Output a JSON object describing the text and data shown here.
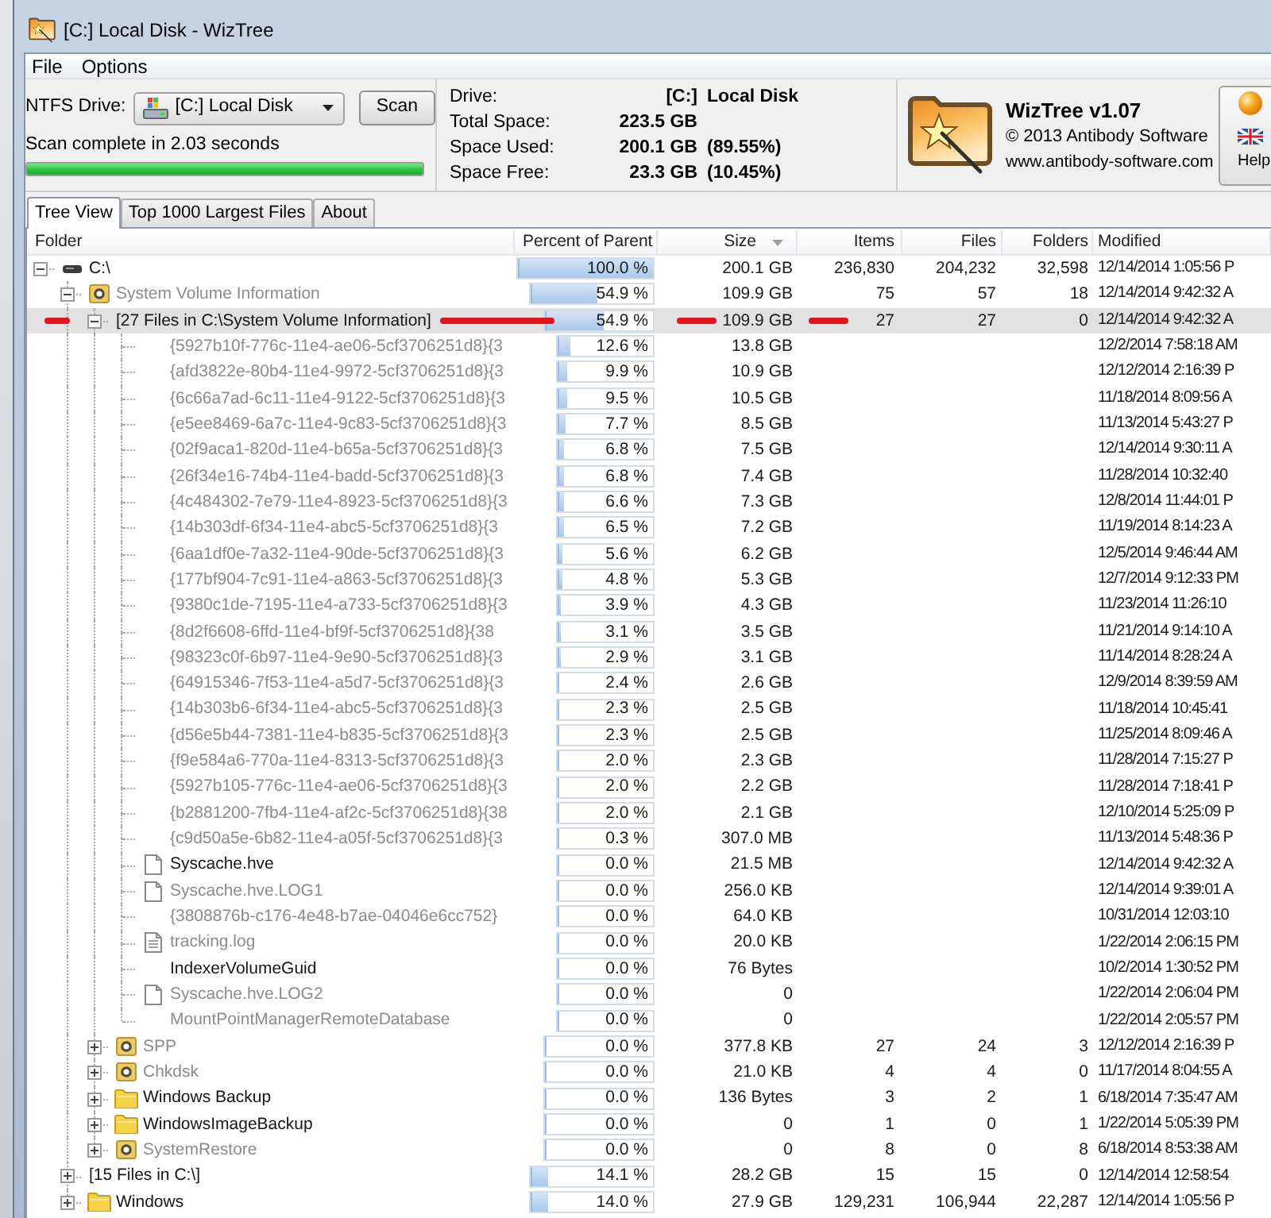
{
  "window": {
    "title": "[C:] Local Disk - WizTree"
  },
  "menu": [
    "File",
    "Options"
  ],
  "scan_panel": {
    "drive_label": "NTFS Drive:",
    "drive": "[C:] Local Disk",
    "scan_button": "Scan",
    "status": "Scan complete in 2.03 seconds",
    "progress": {
      "level": 1
    }
  },
  "drive_info": [
    {
      "label": "Drive:",
      "value": "[C:]",
      "note": "Local Disk"
    },
    {
      "label": "Total Space:",
      "value": "223.5 GB"
    },
    {
      "label": "Space Used:",
      "value": "200.1 GB",
      "note": "(89.55%)"
    },
    {
      "label": "Space Free:",
      "value": "23.3 GB",
      "note": "(10.45%)"
    }
  ],
  "about_panel": {
    "product": "WizTree v1.07",
    "copyright": "© 2013 Antibody Software",
    "website": "www.antibody-software.com",
    "help_button": "Help"
  },
  "tabs": [
    {
      "label": "Tree View",
      "selected": true
    },
    {
      "label": "Top 1000 Largest Files",
      "selected": false
    },
    {
      "label": "About",
      "selected": false
    }
  ],
  "columns": [
    {
      "label": "Folder",
      "sorted": false
    },
    {
      "label": "Percent of Parent",
      "sorted": false
    },
    {
      "label": "Size",
      "sorted": true
    },
    {
      "label": "Items",
      "sorted": false
    },
    {
      "label": "Files",
      "sorted": false
    },
    {
      "label": "Folders",
      "sorted": false
    },
    {
      "label": "Modified",
      "sorted": false
    }
  ],
  "tree": [
    {
      "name": "C:\\",
      "kind": "drive",
      "dimmed": false,
      "selected": false,
      "expanded": true,
      "percent": "100.0 %",
      "level": 1,
      "size": "200.1 GB",
      "items": "236,830",
      "files": "204,232",
      "folders": "32,598",
      "modified": "12/14/2014 1:05:56 P",
      "children": [
        {
          "name": "System Volume Information",
          "kind": "system-folder",
          "dimmed": true,
          "selected": false,
          "expanded": true,
          "percent": "54.9 %",
          "level": 0.549,
          "size": "109.9 GB",
          "items": "75",
          "files": "57",
          "folders": "18",
          "modified": "12/14/2014 9:42:32 A",
          "children": [
            {
              "name": "[27 Files in C:\\System Volume Information]",
              "kind": "group",
              "dimmed": false,
              "selected": true,
              "marked": true,
              "expanded": true,
              "percent": "54.9 %",
              "level": 0.549,
              "size": "109.9 GB",
              "items": "27",
              "files": "27",
              "folders": "0",
              "modified": "12/14/2014 9:42:32 A",
              "children": [
                {
                  "name": "{5927b10f-776c-11e4-ae06-5cf3706251d8}{3",
                  "kind": "entry",
                  "dimmed": true,
                  "selected": false,
                  "percent": "12.6 %",
                  "level": 0.126,
                  "size": "13.8 GB",
                  "modified": "12/2/2014 7:58:18 AM"
                },
                {
                  "name": "{afd3822e-80b4-11e4-9972-5cf3706251d8}{3",
                  "kind": "entry",
                  "dimmed": true,
                  "selected": false,
                  "percent": "9.9 %",
                  "level": 0.099,
                  "size": "10.9 GB",
                  "modified": "12/12/2014 2:16:39 P"
                },
                {
                  "name": "{6c66a7ad-6c11-11e4-9122-5cf3706251d8}{3",
                  "kind": "entry",
                  "dimmed": true,
                  "selected": false,
                  "percent": "9.5 %",
                  "level": 0.095,
                  "size": "10.5 GB",
                  "modified": "11/18/2014 8:09:56 A"
                },
                {
                  "name": "{e5ee8469-6a7c-11e4-9c83-5cf3706251d8}{3",
                  "kind": "entry",
                  "dimmed": true,
                  "selected": false,
                  "percent": "7.7 %",
                  "level": 0.077,
                  "size": "8.5 GB",
                  "modified": "11/13/2014 5:43:27 P"
                },
                {
                  "name": "{02f9aca1-820d-11e4-b65a-5cf3706251d8}{3",
                  "kind": "entry",
                  "dimmed": true,
                  "selected": false,
                  "percent": "6.8 %",
                  "level": 0.068,
                  "size": "7.5 GB",
                  "modified": "12/14/2014 9:30:11 A"
                },
                {
                  "name": "{26f34e16-74b4-11e4-badd-5cf3706251d8}{3",
                  "kind": "entry",
                  "dimmed": true,
                  "selected": false,
                  "percent": "6.8 %",
                  "level": 0.068,
                  "size": "7.4 GB",
                  "modified": "11/28/2014 10:32:40"
                },
                {
                  "name": "{4c484302-7e79-11e4-8923-5cf3706251d8}{3",
                  "kind": "entry",
                  "dimmed": true,
                  "selected": false,
                  "percent": "6.6 %",
                  "level": 0.066,
                  "size": "7.3 GB",
                  "modified": "12/8/2014 11:44:01 P"
                },
                {
                  "name": "{14b303df-6f34-11e4-abc5-5cf3706251d8}{3",
                  "kind": "entry",
                  "dimmed": true,
                  "selected": false,
                  "percent": "6.5 %",
                  "level": 0.065,
                  "size": "7.2 GB",
                  "modified": "11/19/2014 8:14:23 A"
                },
                {
                  "name": "{6aa1df0e-7a32-11e4-90de-5cf3706251d8}{3",
                  "kind": "entry",
                  "dimmed": true,
                  "selected": false,
                  "percent": "5.6 %",
                  "level": 0.056,
                  "size": "6.2 GB",
                  "modified": "12/5/2014 9:46:44 AM"
                },
                {
                  "name": "{177bf904-7c91-11e4-a863-5cf3706251d8}{3",
                  "kind": "entry",
                  "dimmed": true,
                  "selected": false,
                  "percent": "4.8 %",
                  "level": 0.048,
                  "size": "5.3 GB",
                  "modified": "12/7/2014 9:12:33 PM"
                },
                {
                  "name": "{9380c1de-7195-11e4-a733-5cf3706251d8}{3",
                  "kind": "entry",
                  "dimmed": true,
                  "selected": false,
                  "percent": "3.9 %",
                  "level": 0.039,
                  "size": "4.3 GB",
                  "modified": "11/23/2014 11:26:10"
                },
                {
                  "name": "{8d2f6608-6ffd-11e4-bf9f-5cf3706251d8}{38",
                  "kind": "entry",
                  "dimmed": true,
                  "selected": false,
                  "percent": "3.1 %",
                  "level": 0.031,
                  "size": "3.5 GB",
                  "modified": "11/21/2014 9:14:10 A"
                },
                {
                  "name": "{98323c0f-6b97-11e4-9e90-5cf3706251d8}{3",
                  "kind": "entry",
                  "dimmed": true,
                  "selected": false,
                  "percent": "2.9 %",
                  "level": 0.029,
                  "size": "3.1 GB",
                  "modified": "11/14/2014 8:28:24 A"
                },
                {
                  "name": "{64915346-7f53-11e4-a5d7-5cf3706251d8}{3",
                  "kind": "entry",
                  "dimmed": true,
                  "selected": false,
                  "percent": "2.4 %",
                  "level": 0.024,
                  "size": "2.6 GB",
                  "modified": "12/9/2014 8:39:59 AM"
                },
                {
                  "name": "{14b303b6-6f34-11e4-abc5-5cf3706251d8}{3",
                  "kind": "entry",
                  "dimmed": true,
                  "selected": false,
                  "percent": "2.3 %",
                  "level": 0.023,
                  "size": "2.5 GB",
                  "modified": "11/18/2014 10:45:41"
                },
                {
                  "name": "{d56e5b44-7381-11e4-b835-5cf3706251d8}{3",
                  "kind": "entry",
                  "dimmed": true,
                  "selected": false,
                  "percent": "2.3 %",
                  "level": 0.023,
                  "size": "2.5 GB",
                  "modified": "11/25/2014 8:09:46 A"
                },
                {
                  "name": "{f9e584a6-770a-11e4-8313-5cf3706251d8}{3",
                  "kind": "entry",
                  "dimmed": true,
                  "selected": false,
                  "percent": "2.0 %",
                  "level": 0.02,
                  "size": "2.3 GB",
                  "modified": "11/28/2014 7:15:27 P"
                },
                {
                  "name": "{5927b105-776c-11e4-ae06-5cf3706251d8}{3",
                  "kind": "entry",
                  "dimmed": true,
                  "selected": false,
                  "percent": "2.0 %",
                  "level": 0.02,
                  "size": "2.2 GB",
                  "modified": "11/28/2014 7:18:41 P"
                },
                {
                  "name": "{b2881200-7fb4-11e4-af2c-5cf3706251d8}{38",
                  "kind": "entry",
                  "dimmed": true,
                  "selected": false,
                  "percent": "2.0 %",
                  "level": 0.02,
                  "size": "2.1 GB",
                  "modified": "12/10/2014 5:25:09 P"
                },
                {
                  "name": "{c9d50a5e-6b82-11e4-a05f-5cf3706251d8}{3",
                  "kind": "entry",
                  "dimmed": true,
                  "selected": false,
                  "percent": "0.3 %",
                  "level": 0.003,
                  "size": "307.0 MB",
                  "modified": "11/13/2014 5:48:36 P"
                },
                {
                  "name": "Syscache.hve",
                  "kind": "file",
                  "dimmed": false,
                  "selected": false,
                  "percent": "0.0 %",
                  "level": 0,
                  "size": "21.5 MB",
                  "modified": "12/14/2014 9:42:32 A"
                },
                {
                  "name": "Syscache.hve.LOG1",
                  "kind": "file",
                  "dimmed": true,
                  "selected": false,
                  "percent": "0.0 %",
                  "level": 0,
                  "size": "256.0 KB",
                  "modified": "12/14/2014 9:39:01 A"
                },
                {
                  "name": "{3808876b-c176-4e48-b7ae-04046e6cc752}",
                  "kind": "entry",
                  "dimmed": true,
                  "selected": false,
                  "percent": "0.0 %",
                  "level": 0,
                  "size": "64.0 KB",
                  "modified": "10/31/2014 12:03:10"
                },
                {
                  "name": "tracking.log",
                  "kind": "text-file",
                  "dimmed": true,
                  "selected": false,
                  "percent": "0.0 %",
                  "level": 0,
                  "size": "20.0 KB",
                  "modified": "1/22/2014 2:06:15 PM"
                },
                {
                  "name": "IndexerVolumeGuid",
                  "kind": "entry",
                  "dimmed": false,
                  "selected": false,
                  "percent": "0.0 %",
                  "level": 0,
                  "size": "76 Bytes",
                  "modified": "10/2/2014 1:30:52 PM"
                },
                {
                  "name": "Syscache.hve.LOG2",
                  "kind": "file",
                  "dimmed": true,
                  "selected": false,
                  "percent": "0.0 %",
                  "level": 0,
                  "size": "0",
                  "modified": "1/22/2014 2:06:04 PM"
                },
                {
                  "name": "MountPointManagerRemoteDatabase",
                  "kind": "entry",
                  "dimmed": true,
                  "selected": false,
                  "percent": "0.0 %",
                  "level": 0,
                  "size": "0",
                  "modified": "1/22/2014 2:05:57 PM"
                }
              ]
            },
            {
              "name": "SPP",
              "kind": "system-folder",
              "dimmed": true,
              "selected": false,
              "expanded": false,
              "percent": "0.0 %",
              "level": 0,
              "size": "377.8 KB",
              "items": "27",
              "files": "24",
              "folders": "3",
              "modified": "12/12/2014 2:16:39 P"
            },
            {
              "name": "Chkdsk",
              "kind": "system-folder",
              "dimmed": true,
              "selected": false,
              "expanded": false,
              "percent": "0.0 %",
              "level": 0,
              "size": "21.0 KB",
              "items": "4",
              "files": "4",
              "folders": "0",
              "modified": "11/17/2014 8:04:55 A"
            },
            {
              "name": "Windows Backup",
              "kind": "folder",
              "dimmed": false,
              "selected": false,
              "expanded": false,
              "percent": "0.0 %",
              "level": 0,
              "size": "136 Bytes",
              "items": "3",
              "files": "2",
              "folders": "1",
              "modified": "6/18/2014 7:35:47 AM"
            },
            {
              "name": "WindowsImageBackup",
              "kind": "folder",
              "dimmed": false,
              "selected": false,
              "expanded": false,
              "percent": "0.0 %",
              "level": 0,
              "size": "0",
              "items": "1",
              "files": "0",
              "folders": "1",
              "modified": "1/22/2014 5:05:39 PM"
            },
            {
              "name": "SystemRestore",
              "kind": "system-folder",
              "dimmed": true,
              "selected": false,
              "expanded": false,
              "percent": "0.0 %",
              "level": 0,
              "size": "0",
              "items": "8",
              "files": "0",
              "folders": "8",
              "modified": "6/18/2014 8:53:38 AM"
            }
          ]
        },
        {
          "name": "[15 Files in C:\\]",
          "kind": "group",
          "dimmed": false,
          "selected": false,
          "expanded": false,
          "percent": "14.1 %",
          "level": 0.141,
          "size": "28.2 GB",
          "items": "15",
          "files": "15",
          "folders": "0",
          "modified": "12/14/2014 12:58:54"
        },
        {
          "name": "Windows",
          "kind": "folder",
          "dimmed": false,
          "selected": false,
          "expanded": false,
          "percent": "14.0 %",
          "level": 0.14,
          "size": "27.9 GB",
          "items": "129,231",
          "files": "106,944",
          "folders": "22,287",
          "modified": "12/14/2014 1:05:56 P"
        }
      ]
    }
  ]
}
